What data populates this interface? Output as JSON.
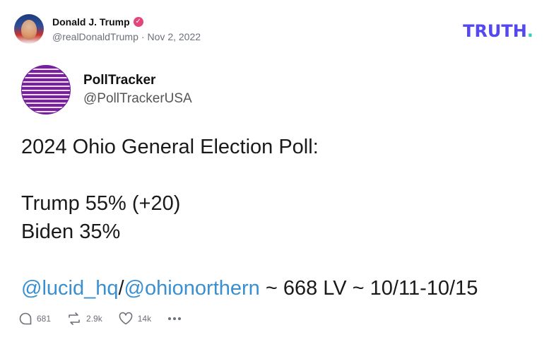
{
  "post": {
    "display_name": "Donald J. Trump",
    "handle": "@realDonaldTrump",
    "separator": "·",
    "date": "Nov 2, 2022"
  },
  "brand": {
    "text": "TRUTH",
    "dot": "."
  },
  "quoted": {
    "name": "PollTracker",
    "handle": "@PollTrackerUSA",
    "lines": {
      "title": "2024 Ohio General Election Poll:",
      "trump": "Trump 55% (+20)",
      "biden": "Biden 35%"
    },
    "mention1": "@lucid_hq",
    "slash": "/",
    "mention2": "@ohionorthern",
    "tail": " ~ 668 LV ~ 10/11-10/15"
  },
  "actions": {
    "replies": "681",
    "retruths": "2.9k",
    "likes": "14k"
  },
  "colors": {
    "brand": "#5448ee",
    "brand_dot": "#33d1b3",
    "verified": "#e2467a",
    "mention": "#3a8fd0"
  },
  "icons": [
    "reply-icon",
    "retruth-icon",
    "heart-icon",
    "more-icon",
    "verified-icon"
  ]
}
